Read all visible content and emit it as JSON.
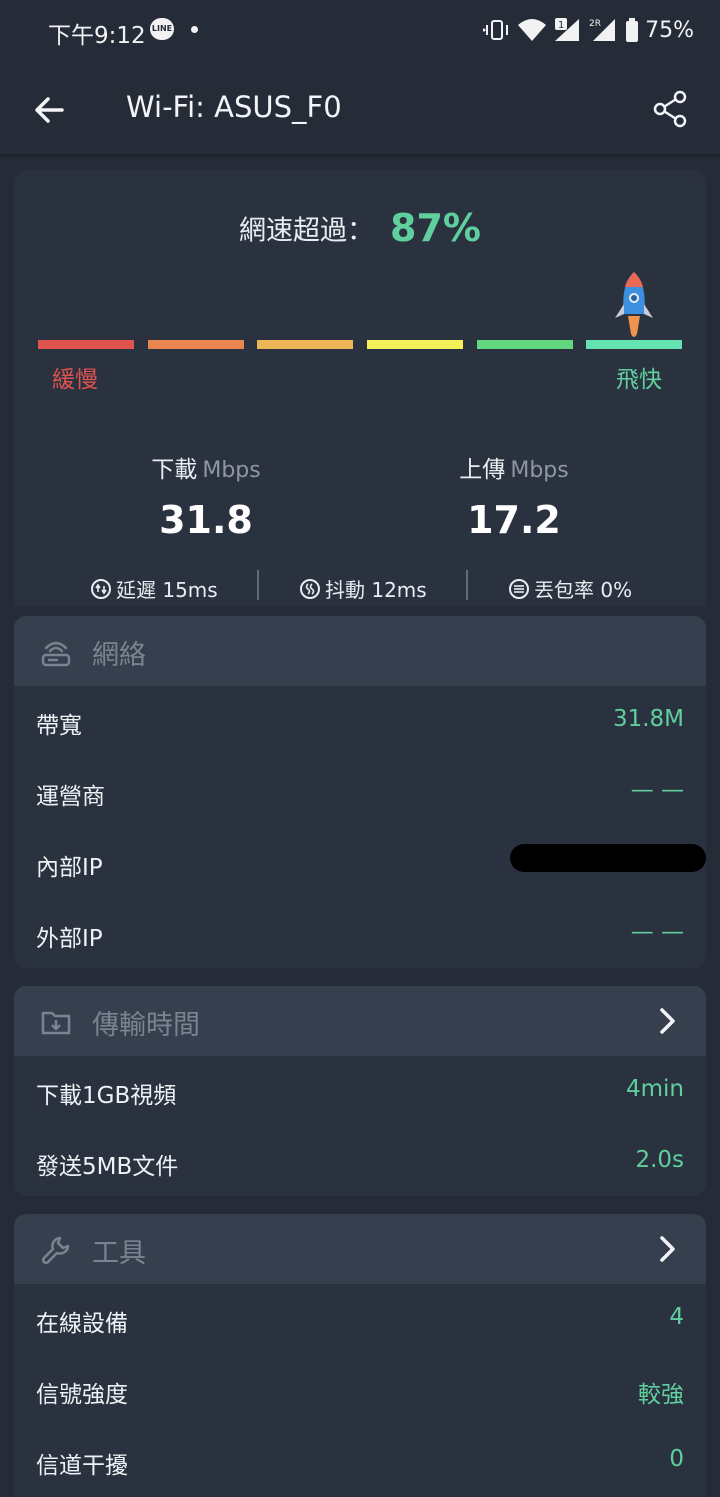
{
  "status_bar": {
    "time": "下午9:12",
    "line_badge": "LINE",
    "battery": "75%"
  },
  "header": {
    "title": "Wi-Fi: ASUS_F0",
    "icons": [
      "back-arrow-icon",
      "share-icon"
    ]
  },
  "speed": {
    "exceed_label": "網速超過：",
    "exceed_value": "87%",
    "slow_label": "緩慢",
    "fast_label": "飛快",
    "meter_colors": [
      "#e0534e",
      "#e98650",
      "#edb658",
      "#f3f05a",
      "#61d77e",
      "#64e3b1"
    ],
    "download": {
      "label": "下載",
      "unit": "Mbps",
      "value": "31.8"
    },
    "upload": {
      "label": "上傳",
      "unit": "Mbps",
      "value": "17.2"
    },
    "latency": "延遲 15ms",
    "jitter": "抖動 12ms",
    "packet_loss": "丟包率 0%"
  },
  "network": {
    "title": "網絡",
    "rows": [
      {
        "label": "帶寬",
        "value": "31.8M"
      },
      {
        "label": "運營商",
        "value": "— —"
      },
      {
        "label": "內部IP",
        "value": ""
      },
      {
        "label": "外部IP",
        "value": "— —"
      }
    ]
  },
  "transfer": {
    "title": "傳輸時間",
    "rows": [
      {
        "label": "下載1GB視頻",
        "value": "4min"
      },
      {
        "label": "發送5MB文件",
        "value": "2.0s"
      }
    ]
  },
  "tools": {
    "title": "工具",
    "rows": [
      {
        "label": "在線設備",
        "value": "4"
      },
      {
        "label": "信號強度",
        "value": "較強"
      },
      {
        "label": "信道干擾",
        "value": "0"
      }
    ]
  },
  "colors": {
    "accent_green": "#5fcf9d",
    "slow_red": "#e0534e",
    "background": "#252c38",
    "card": "#2b323f"
  }
}
